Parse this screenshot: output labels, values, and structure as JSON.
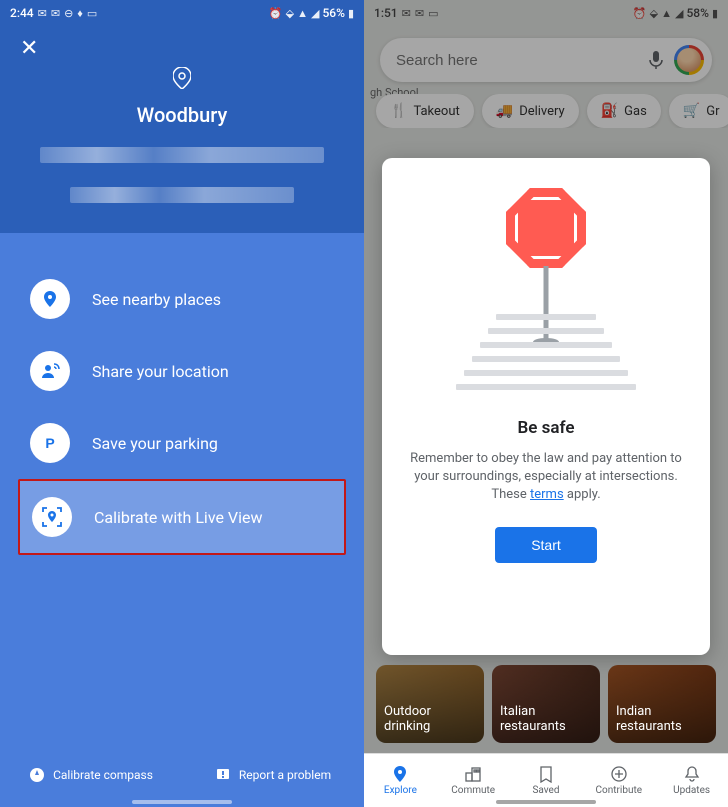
{
  "left": {
    "statusbar": {
      "time": "2:44",
      "battery": "56%"
    },
    "location_title": "Woodbury",
    "actions": {
      "nearby": "See nearby places",
      "share": "Share your location",
      "parking": "Save your parking",
      "calibrate": "Calibrate with Live View"
    },
    "footer": {
      "compass": "Calibrate compass",
      "report": "Report a problem"
    }
  },
  "right": {
    "statusbar": {
      "time": "1:51",
      "battery": "58%"
    },
    "search_placeholder": "Search here",
    "map_label_school": "gh School",
    "chips": {
      "takeout": "Takeout",
      "delivery": "Delivery",
      "gas": "Gas",
      "groceries": "Gr"
    },
    "popup": {
      "title": "Be safe",
      "body_pre": "Remember to obey the law and pay attention to your surroundings, especially at intersections. These ",
      "terms_link": "terms",
      "body_post": " apply.",
      "start": "Start"
    },
    "cards": {
      "c1": "Outdoor drinking",
      "c2": "Italian restaurants",
      "c3": "Indian restaurants"
    },
    "nav": {
      "explore": "Explore",
      "commute": "Commute",
      "saved": "Saved",
      "contribute": "Contribute",
      "updates": "Updates"
    }
  }
}
